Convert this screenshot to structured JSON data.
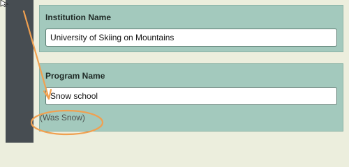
{
  "institution": {
    "label": "Institution Name",
    "value": "University of Skiing on Mountains"
  },
  "program": {
    "label": "Program Name",
    "value": "Snow school",
    "previous_name": "(Was Snow)"
  },
  "colors": {
    "page_background": "#eceedd",
    "sidebar": "#474d52",
    "panel": "#a3c9bd",
    "annotation": "#f0a050"
  },
  "icons": [
    "cursor-icon",
    "annotation-arrow",
    "annotation-ellipse"
  ]
}
